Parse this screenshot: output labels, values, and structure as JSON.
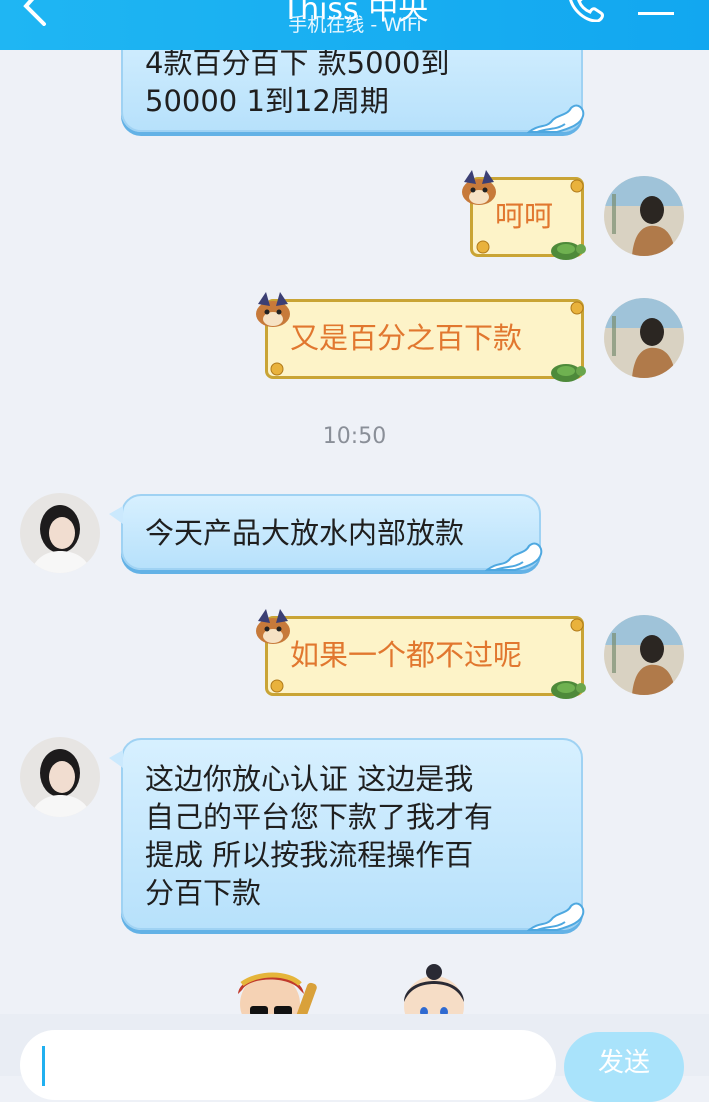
{
  "header": {
    "title": "Thiss 中央",
    "status": "手机在线 - WiFi",
    "back_icon": "chevron-left-icon",
    "call_icon": "phone-icon",
    "menu_icon": "menu-icon"
  },
  "messages": [
    {
      "side": "in",
      "text_lines": [
        "4款百分百下 款5000到",
        "50000 1到12周期"
      ]
    },
    {
      "side": "out",
      "text": "呵呵"
    },
    {
      "side": "out",
      "text": "又是百分之百下款"
    },
    {
      "time": "10:50"
    },
    {
      "side": "in",
      "text": "今天产品大放水内部放款"
    },
    {
      "side": "out",
      "text": "如果一个都不过呢"
    },
    {
      "side": "in",
      "text_lines": [
        "这边你放心认证 这边是我",
        "自己的平台您下款了我才有",
        "提成 所以按我流程操作百",
        "分百下款"
      ]
    }
  ],
  "input": {
    "value": "",
    "send_label": "发送"
  },
  "colors": {
    "header_bg": "#1fb6f3",
    "incoming_bubble": "#c7e8fc",
    "outgoing_bubble": "#fdf3c8",
    "outgoing_text": "#e1772f",
    "send_button": "#a9e3fb"
  }
}
